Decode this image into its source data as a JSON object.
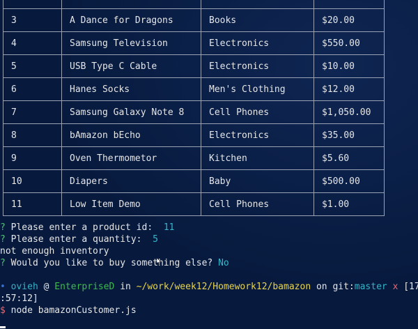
{
  "table": {
    "rows": [
      {
        "id": "",
        "name": "",
        "dept": "",
        "price": ""
      },
      {
        "id": "3",
        "name": "A Dance for Dragons",
        "dept": "Books",
        "price": "$20.00"
      },
      {
        "id": "4",
        "name": "Samsung Television",
        "dept": "Electronics",
        "price": "$550.00"
      },
      {
        "id": "5",
        "name": "USB Type C Cable",
        "dept": "Electronics",
        "price": "$10.00"
      },
      {
        "id": "6",
        "name": "Hanes Socks",
        "dept": "Men's Clothing",
        "price": "$12.00"
      },
      {
        "id": "7",
        "name": "Samsung Galaxy Note 8",
        "dept": "Cell Phones",
        "price": "$1,050.00"
      },
      {
        "id": "8",
        "name": "bAmazon bEcho",
        "dept": "Electronics",
        "price": "$35.00"
      },
      {
        "id": "9",
        "name": "Oven Thermometor",
        "dept": "Kitchen",
        "price": "$5.60"
      },
      {
        "id": "10",
        "name": "Diapers",
        "dept": "Baby",
        "price": "$500.00"
      },
      {
        "id": "11",
        "name": "Low Item Demo",
        "dept": "Cell Phones",
        "price": "$1.00"
      }
    ]
  },
  "prompts": {
    "q_mark": "?",
    "product_id_label": "Please enter a product id:",
    "product_id_value": "11",
    "quantity_label": "Please enter a quantity:",
    "quantity_value": "5",
    "inventory_message": "not enough inventory",
    "buy_again_label": "Would you like to buy something else?",
    "buy_again_value": "No"
  },
  "shell": {
    "user": "ovieh",
    "at": "@",
    "host": "EnterpriseD",
    "in_word": "in",
    "path": "~/work/week12/Homework12/bamazon",
    "on_word": "on",
    "git_label": "git:",
    "branch": "master",
    "dirty_mark": "x",
    "time_part1": "[17",
    "time_part2": ":57:12]",
    "dollar": "$",
    "command": "node bamazonCustomer.js"
  },
  "colors": {
    "background": "#071a3e",
    "text": "#e6e6e6",
    "prompt_green": "#49c76b",
    "answer_cyan": "#38b6c9",
    "host_green": "#3fb950",
    "path_yellow": "#e8d44d",
    "dollar_red": "#e06c75"
  }
}
